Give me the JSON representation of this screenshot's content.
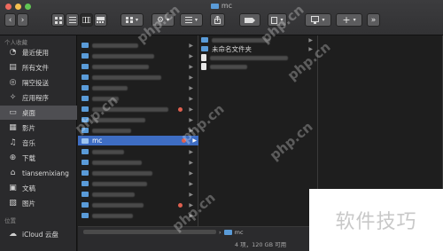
{
  "window": {
    "title": "mc"
  },
  "sidebar": {
    "sections": [
      {
        "label": "个人收藏"
      },
      {
        "label": "位置"
      }
    ],
    "items": [
      {
        "label": "最近使用",
        "icon": "clock-icon"
      },
      {
        "label": "所有文件",
        "icon": "all-files-icon"
      },
      {
        "label": "隔空投送",
        "icon": "airdrop-icon"
      },
      {
        "label": "应用程序",
        "icon": "apps-icon"
      },
      {
        "label": "桌面",
        "icon": "desktop-icon"
      },
      {
        "label": "影片",
        "icon": "film-icon"
      },
      {
        "label": "音乐",
        "icon": "music-icon"
      },
      {
        "label": "下载",
        "icon": "download-icon"
      },
      {
        "label": "tiansemixiang",
        "icon": "home-icon"
      },
      {
        "label": "文稿",
        "icon": "documents-icon"
      },
      {
        "label": "图片",
        "icon": "pictures-icon"
      }
    ],
    "locations": [
      {
        "label": "iCloud 云盘",
        "icon": "cloud-icon"
      }
    ]
  },
  "columns": {
    "middle": {
      "selected_label": "mc"
    },
    "right": {
      "items": [
        {
          "label": "未命名文件夹"
        }
      ]
    }
  },
  "pathbar": {
    "label": "mc"
  },
  "status": {
    "text": "4 项，120 GB 可用"
  },
  "watermark": {
    "text": "php.cn",
    "badge": "软件技巧"
  },
  "colors": {
    "selection": "#3e6dc3",
    "folder": "#5a9bd8",
    "tag_red": "#e0604f"
  }
}
